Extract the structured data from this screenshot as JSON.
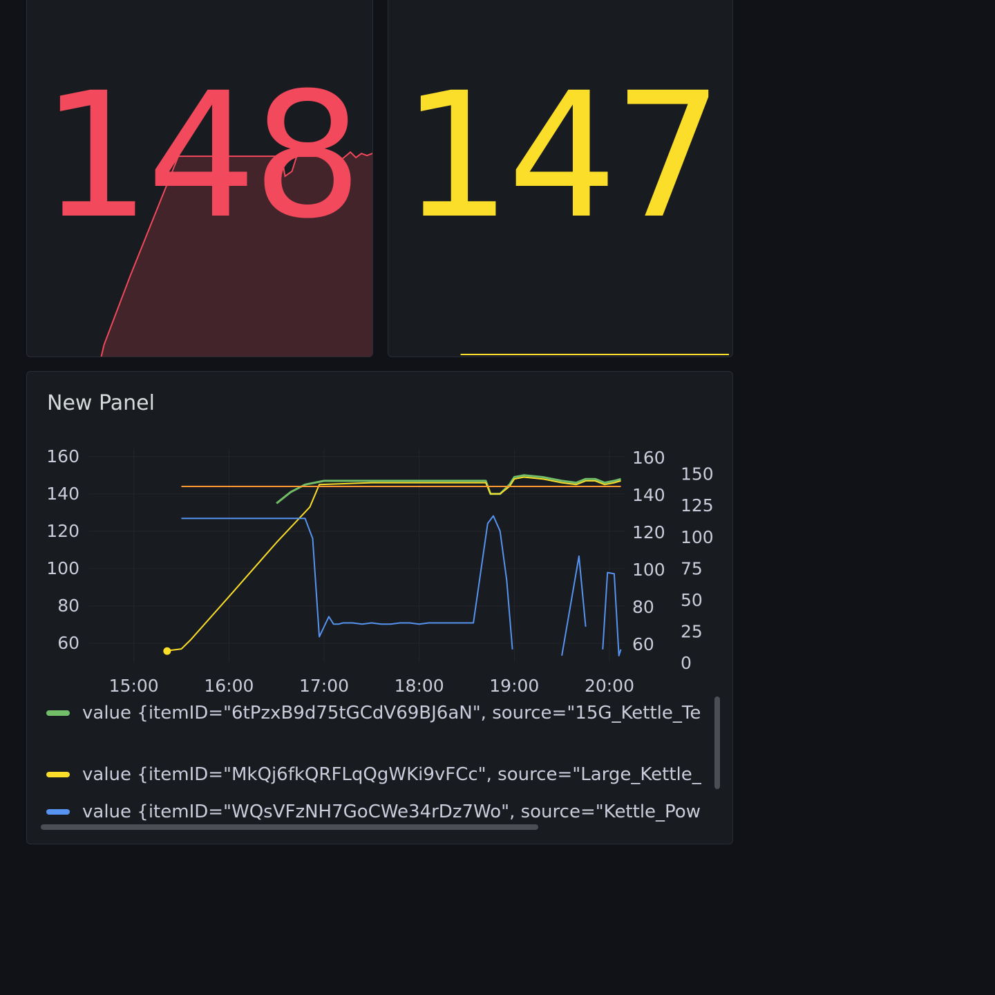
{
  "stat_panels": [
    {
      "value": "148",
      "color": "#f2495c"
    },
    {
      "value": "147",
      "color": "#fade2a"
    }
  ],
  "timeseries": {
    "title": "New Panel",
    "legend": [
      {
        "label": "value {itemID=\"6tPzxB9d75tGCdV69BJ6aN\", source=\"15G_Kettle_Te",
        "color": "#73bf69"
      },
      {
        "label": "value {itemID=\"MkQj6fkQRFLqQgWKi9vFCc\", source=\"Large_Kettle_",
        "color": "#fade2a"
      },
      {
        "label": "value {itemID=\"WQsVFzNH7GoCWe34rDz7Wo\", source=\"Kettle_Pow",
        "color": "#5794f2"
      }
    ]
  },
  "chart_data": {
    "type": "line",
    "x_ticks": [
      "15:00",
      "16:00",
      "17:00",
      "18:00",
      "19:00",
      "20:00"
    ],
    "xlim": [
      14.53,
      20.16
    ],
    "y_left_ticks": [
      160,
      140,
      120,
      100,
      80,
      60
    ],
    "y_left_lim": [
      50,
      164
    ],
    "y_right1_ticks": [
      160,
      140,
      120,
      100,
      80,
      60
    ],
    "y_right1_lim": [
      50,
      164
    ],
    "y_right2_ticks": [
      150,
      125,
      100,
      75,
      50,
      25,
      0
    ],
    "y_right2_lim": [
      0,
      169
    ],
    "grid": true,
    "legend_position": "bottom",
    "series": [
      {
        "color": "#73bf69",
        "axis": "right1",
        "x": [
          16.5,
          16.65,
          16.8,
          16.9,
          17.0,
          17.5,
          18.0,
          18.4,
          18.7,
          18.75,
          18.85,
          18.95,
          19.0,
          19.1,
          19.3,
          19.5,
          19.65,
          19.75,
          19.85,
          19.95,
          20.05,
          20.12
        ],
        "y": [
          135,
          141,
          145,
          146,
          147,
          147,
          147,
          147,
          147,
          140,
          140,
          145,
          149,
          150,
          149,
          147,
          146,
          148,
          148,
          146,
          147,
          148
        ]
      },
      {
        "color": "#fade2a",
        "axis": "left",
        "x": [
          15.35,
          15.5,
          15.6,
          16.0,
          16.5,
          16.85,
          16.95,
          17.5,
          18.0,
          18.4,
          18.7,
          18.75,
          18.85,
          18.95,
          19.0,
          19.1,
          19.3,
          19.5,
          19.65,
          19.75,
          19.85,
          19.95,
          20.05,
          20.12
        ],
        "y": [
          56,
          57,
          62,
          85,
          114,
          133,
          145,
          146,
          146,
          146,
          146,
          140,
          140,
          144,
          148,
          149,
          148,
          146,
          145,
          147,
          147,
          145,
          146,
          147
        ]
      },
      {
        "color": "#ff9830",
        "axis": "left",
        "x": [
          15.5,
          20.12
        ],
        "y": [
          144,
          144
        ]
      },
      {
        "color": "#5794f2",
        "axis": "right2",
        "segments": [
          {
            "x": [
              15.5,
              16.3,
              16.8,
              16.88,
              16.95,
              17.0,
              17.05,
              17.1,
              17.15,
              17.2,
              17.3,
              17.4,
              17.5,
              17.6,
              17.7,
              17.8,
              17.9,
              18.0,
              18.1,
              18.3,
              18.35,
              18.4,
              18.5,
              18.57,
              18.72,
              18.78,
              18.85,
              18.92,
              18.98
            ],
            "y": [
              114,
              114,
              114,
              98,
              20,
              28,
              36,
              30,
              30,
              31,
              31,
              30,
              31,
              30,
              30,
              31,
              31,
              30,
              31,
              31,
              31,
              31,
              31,
              31,
              110,
              116,
              104,
              65,
              10
            ]
          },
          {
            "x": [
              19.5,
              19.68,
              19.75
            ],
            "y": [
              5,
              84,
              28
            ]
          },
          {
            "x": [
              19.93,
              19.98,
              20.05,
              20.1,
              20.12
            ],
            "y": [
              10,
              71,
              70,
              5,
              10
            ]
          }
        ]
      }
    ]
  }
}
